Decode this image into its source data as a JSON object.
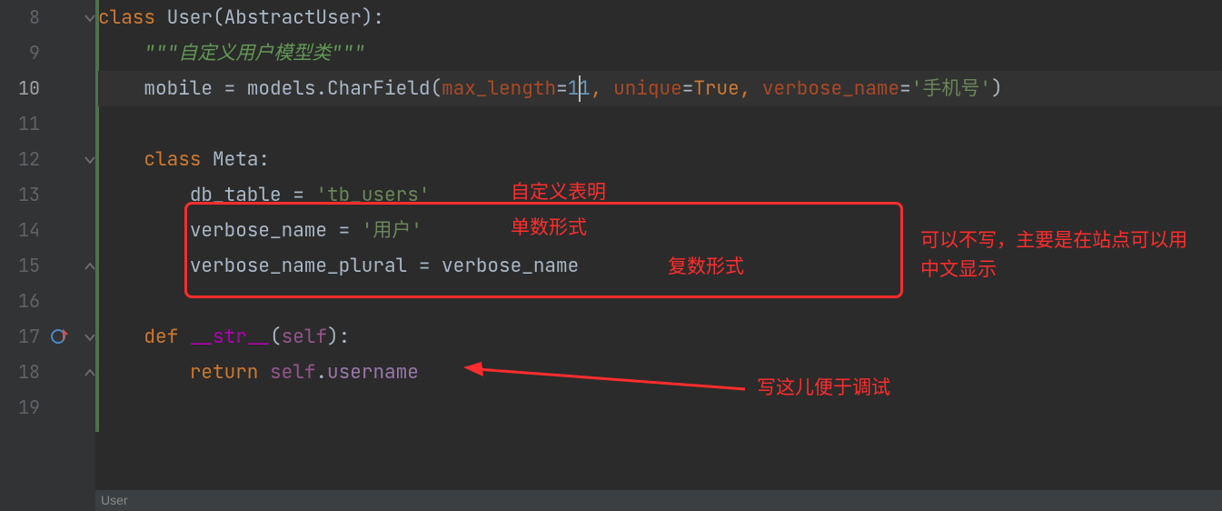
{
  "gutter": {
    "lines": [
      "8",
      "9",
      "10",
      "11",
      "12",
      "13",
      "14",
      "15",
      "16",
      "17",
      "18",
      "19"
    ],
    "current_line_index": 2
  },
  "code": {
    "l8": {
      "indent": "",
      "kw1": "class",
      "sp": " ",
      "name": "User",
      "p1": "(",
      "base": "AbstractUser",
      "p2": "):"
    },
    "l9": {
      "indent": "    ",
      "doc": "\"\"\"自定义用户模型类\"\"\""
    },
    "l10": {
      "indent": "    ",
      "attr": "mobile",
      "eq": " = ",
      "mod": "models",
      "dot": ".",
      "fn": "CharField",
      "p1": "(",
      "k1": "max_length",
      "e1": "=",
      "v1a": "1",
      "v1b": "1",
      "c1": ", ",
      "k2": "unique",
      "e2": "=",
      "v2": "True",
      "c2": ", ",
      "k3": "verbose_name",
      "e3": "=",
      "v3": "'手机号'",
      "p2": ")"
    },
    "l12": {
      "indent": "    ",
      "kw": "class",
      "sp": " ",
      "name": "Meta",
      "colon": ":"
    },
    "l13": {
      "indent": "        ",
      "attr": "db_table",
      "eq": " = ",
      "val": "'tb_users'"
    },
    "l14": {
      "indent": "        ",
      "attr": "verbose_name",
      "eq": " = ",
      "val": "'用户'"
    },
    "l15": {
      "indent": "        ",
      "attr": "verbose_name_plural",
      "eq": " = ",
      "rhs": "verbose_name"
    },
    "l17": {
      "indent": "    ",
      "kw": "def",
      "sp": " ",
      "name": "__str__",
      "p1": "(",
      "self": "self",
      "p2": "):"
    },
    "l18": {
      "indent": "        ",
      "kw": "return",
      "sp": " ",
      "self": "self",
      "dot": ".",
      "attr": "username"
    }
  },
  "annotations": {
    "a13": "自定义表明",
    "a14": "单数形式",
    "a15": "复数形式",
    "side": "可以不写，主要是在站点可以用中文显示",
    "debug": "写这儿便于调试"
  },
  "breadcrumb": {
    "text": "User"
  }
}
